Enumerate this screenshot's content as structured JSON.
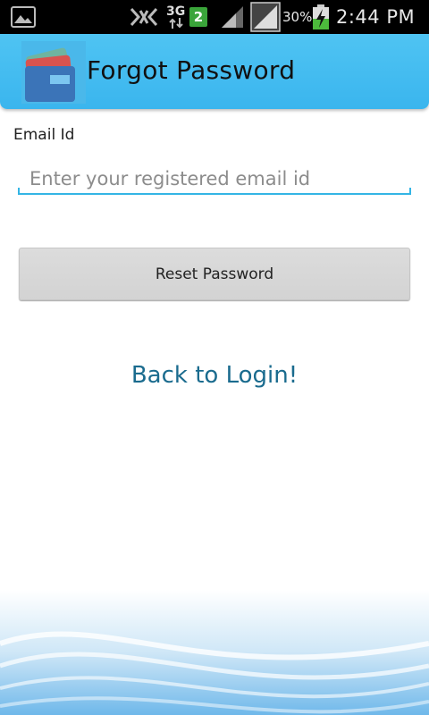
{
  "status_bar": {
    "network_type": "3G",
    "sim_badge": "2",
    "battery_percent": "30%",
    "time": "2:44 PM",
    "icons": [
      "gallery-icon",
      "no-signal-icon",
      "data-arrows-icon",
      "signal-icon",
      "signal-box-icon",
      "battery-charging-icon"
    ]
  },
  "app_bar": {
    "title": "Forgot Password",
    "logo": "wallet-cards-icon",
    "color": "#3ab5ee"
  },
  "form": {
    "email_label": "Email Id",
    "email_value": "",
    "email_placeholder": "Enter your registered email id",
    "reset_button": "Reset Password",
    "back_link": "Back to Login!",
    "accent_color": "#33b5e5",
    "link_color": "#1a6b8e"
  }
}
